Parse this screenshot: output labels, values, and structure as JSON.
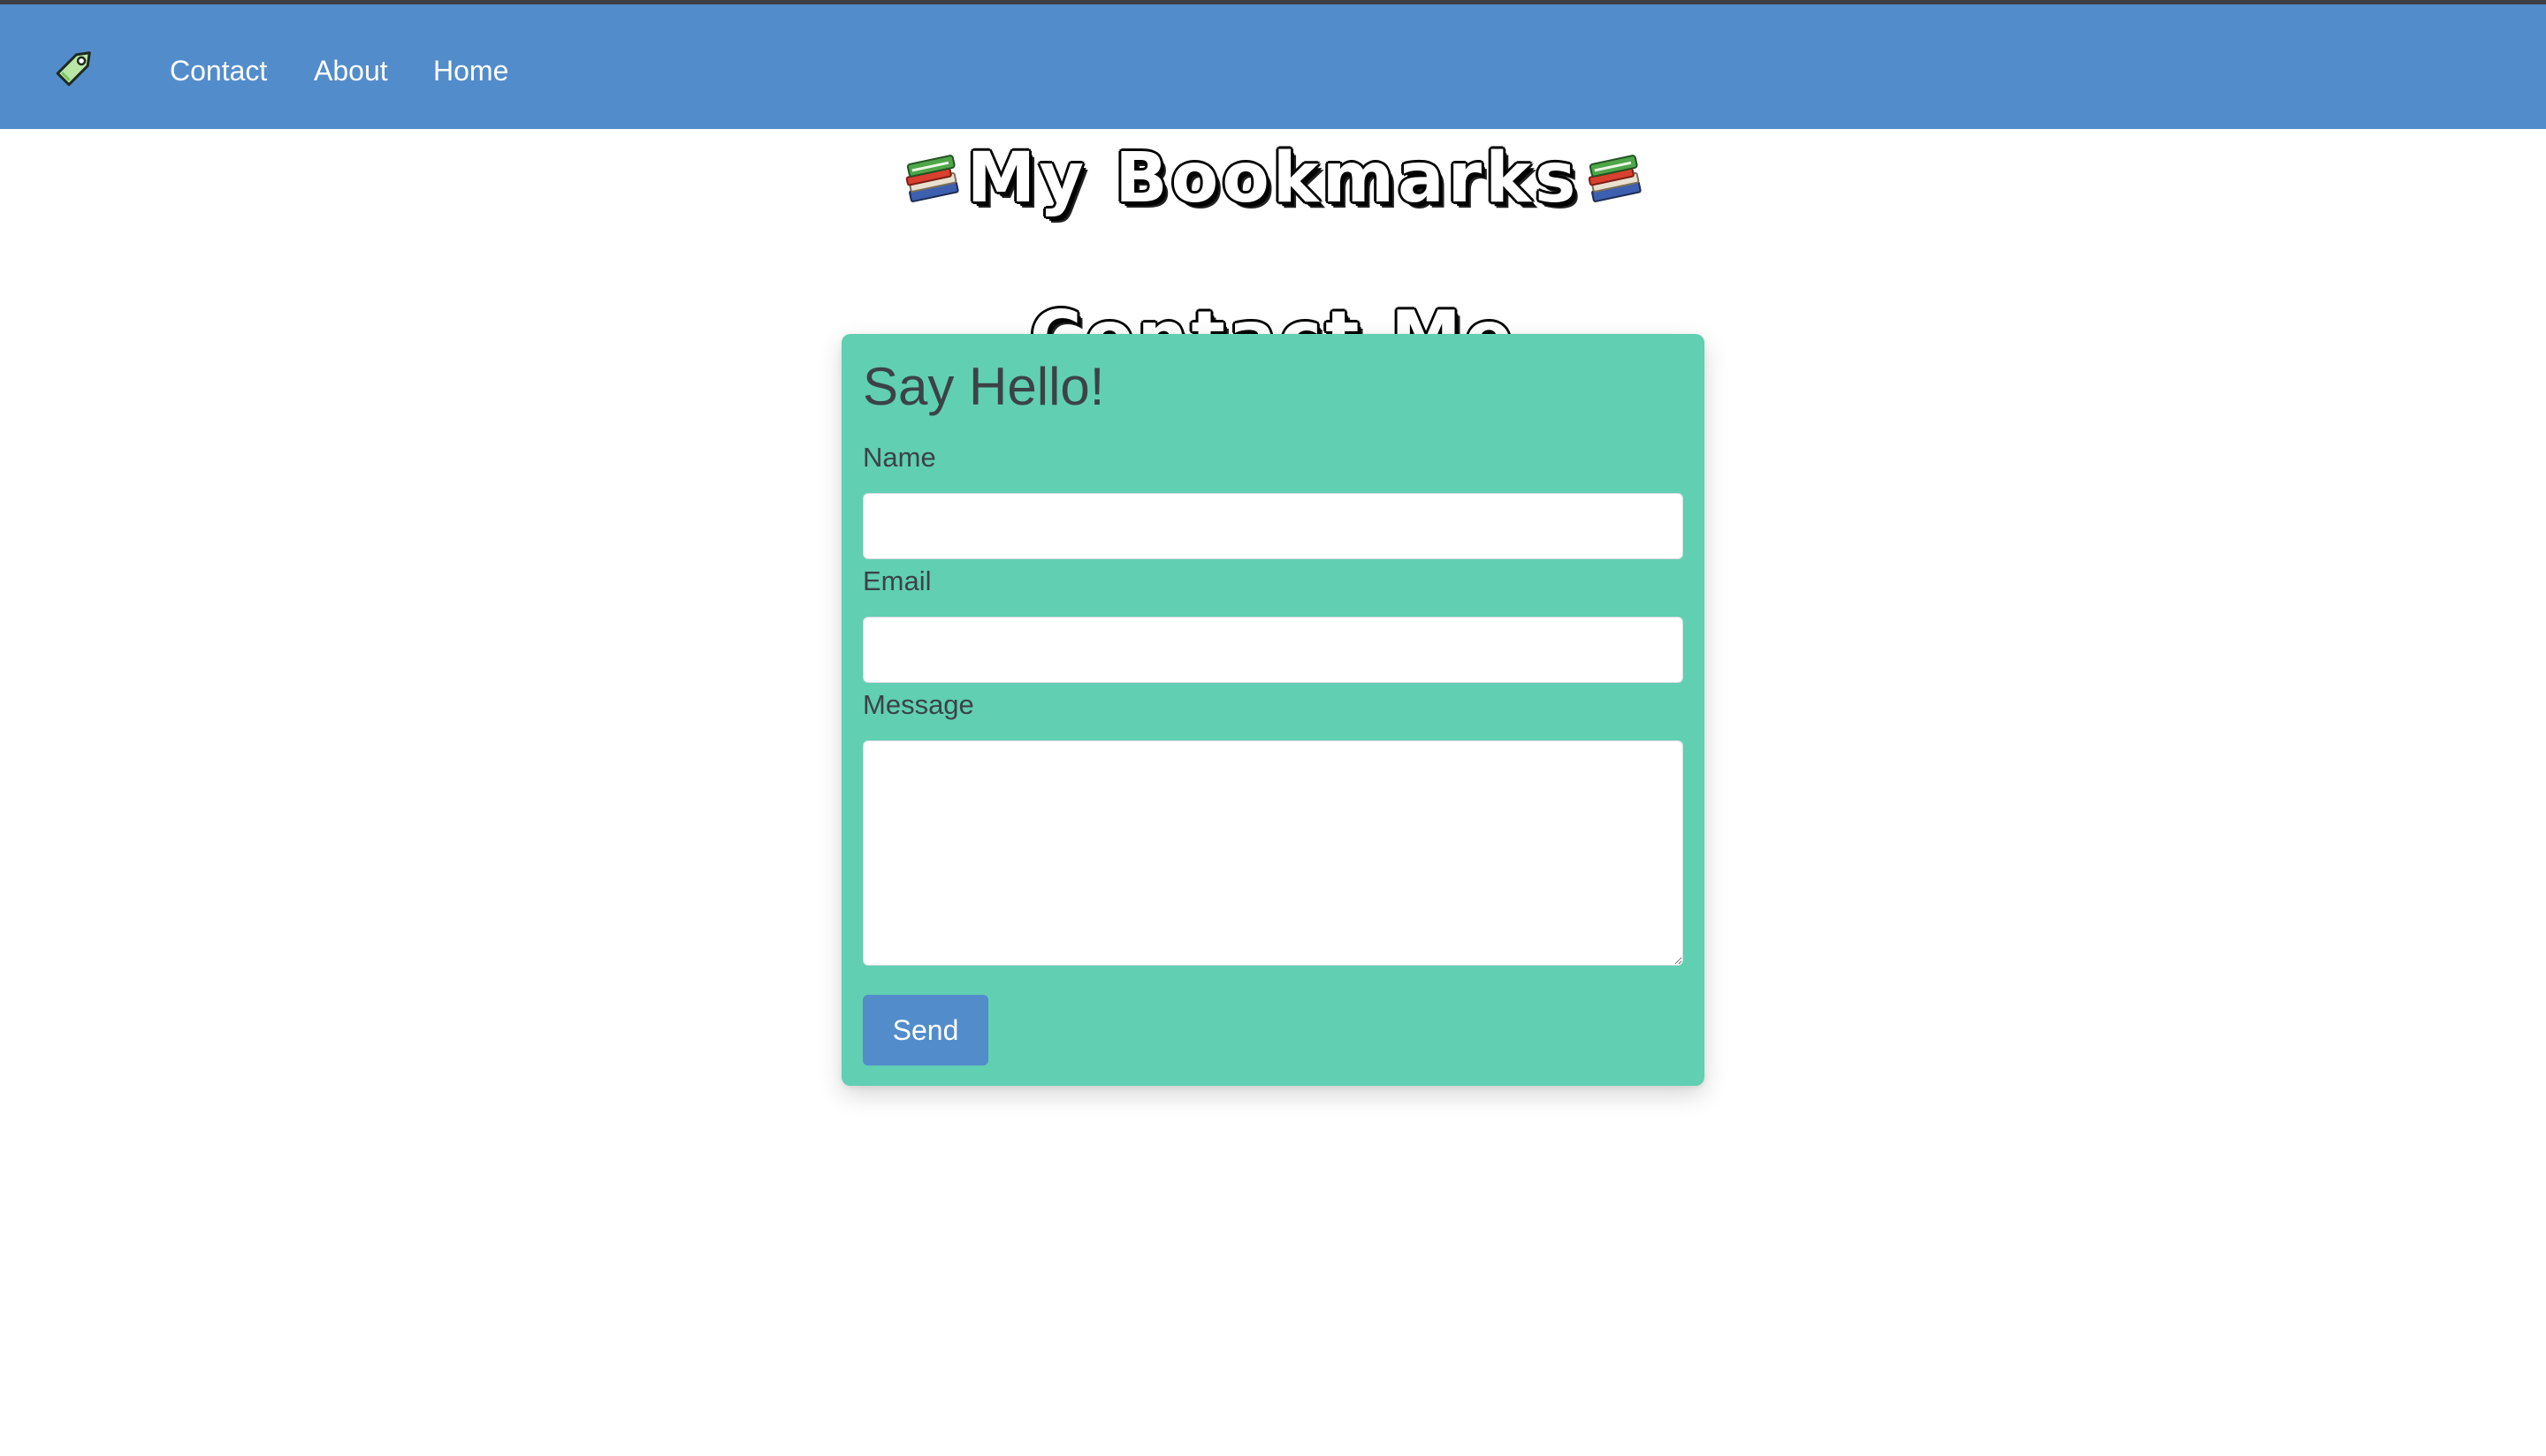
{
  "nav": {
    "logo_icon": "tag-icon",
    "links": [
      {
        "label": "Contact"
      },
      {
        "label": "About"
      },
      {
        "label": "Home"
      }
    ]
  },
  "header": {
    "site_title": "My Bookmarks",
    "title_icon": "books-icon",
    "page_title": "Contact Me"
  },
  "form": {
    "heading": "Say Hello!",
    "name_label": "Name",
    "name_value": "",
    "email_label": "Email",
    "email_value": "",
    "message_label": "Message",
    "message_value": "",
    "send_label": "Send"
  },
  "colors": {
    "navbar": "#528ccb",
    "card": "#61cfb2",
    "button": "#528ccb",
    "text": "#3b4346"
  }
}
